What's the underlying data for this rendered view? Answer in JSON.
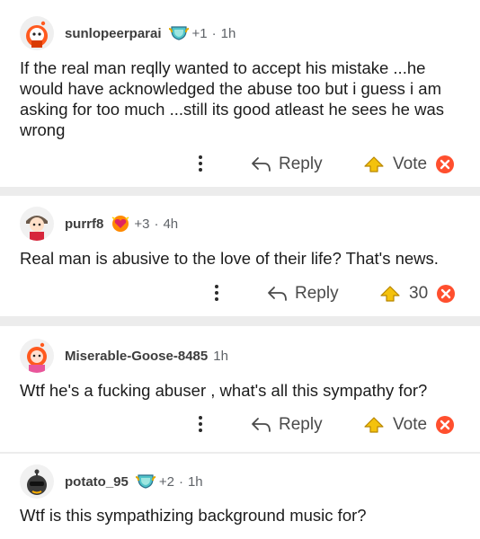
{
  "comments": [
    {
      "username": "sunlopeerparai",
      "award_count": "+1",
      "time": "1h",
      "badge_icon": "trophy-badge-icon",
      "body": "If the real man reqlly wanted to accept his mistake ...he would have acknowledged the abuse too but i guess i am asking for too much ...still its good atleast he sees he was wrong",
      "reply_label": "Reply",
      "vote_label": "Vote"
    },
    {
      "username": "purrf8",
      "award_count": "+3",
      "time": "4h",
      "badge_icon": "heart-badge-icon",
      "body": "Real man is abusive to the love of their life? That's news.",
      "reply_label": "Reply",
      "vote_label": "30"
    },
    {
      "username": "Miserable-Goose-8485",
      "time": "1h",
      "body": "Wtf he's a fucking abuser , what's all this sympathy for?",
      "reply_label": "Reply",
      "vote_label": "Vote"
    },
    {
      "username": "potato_95",
      "award_count": "+2",
      "time": "1h",
      "badge_icon": "trophy-badge-icon",
      "body": "Wtf is this sympathizing background music for?"
    }
  ],
  "colors": {
    "upvote": "#e8b400",
    "downvote": "#ff4f2e",
    "separator": "#ececec"
  },
  "separator": "·"
}
